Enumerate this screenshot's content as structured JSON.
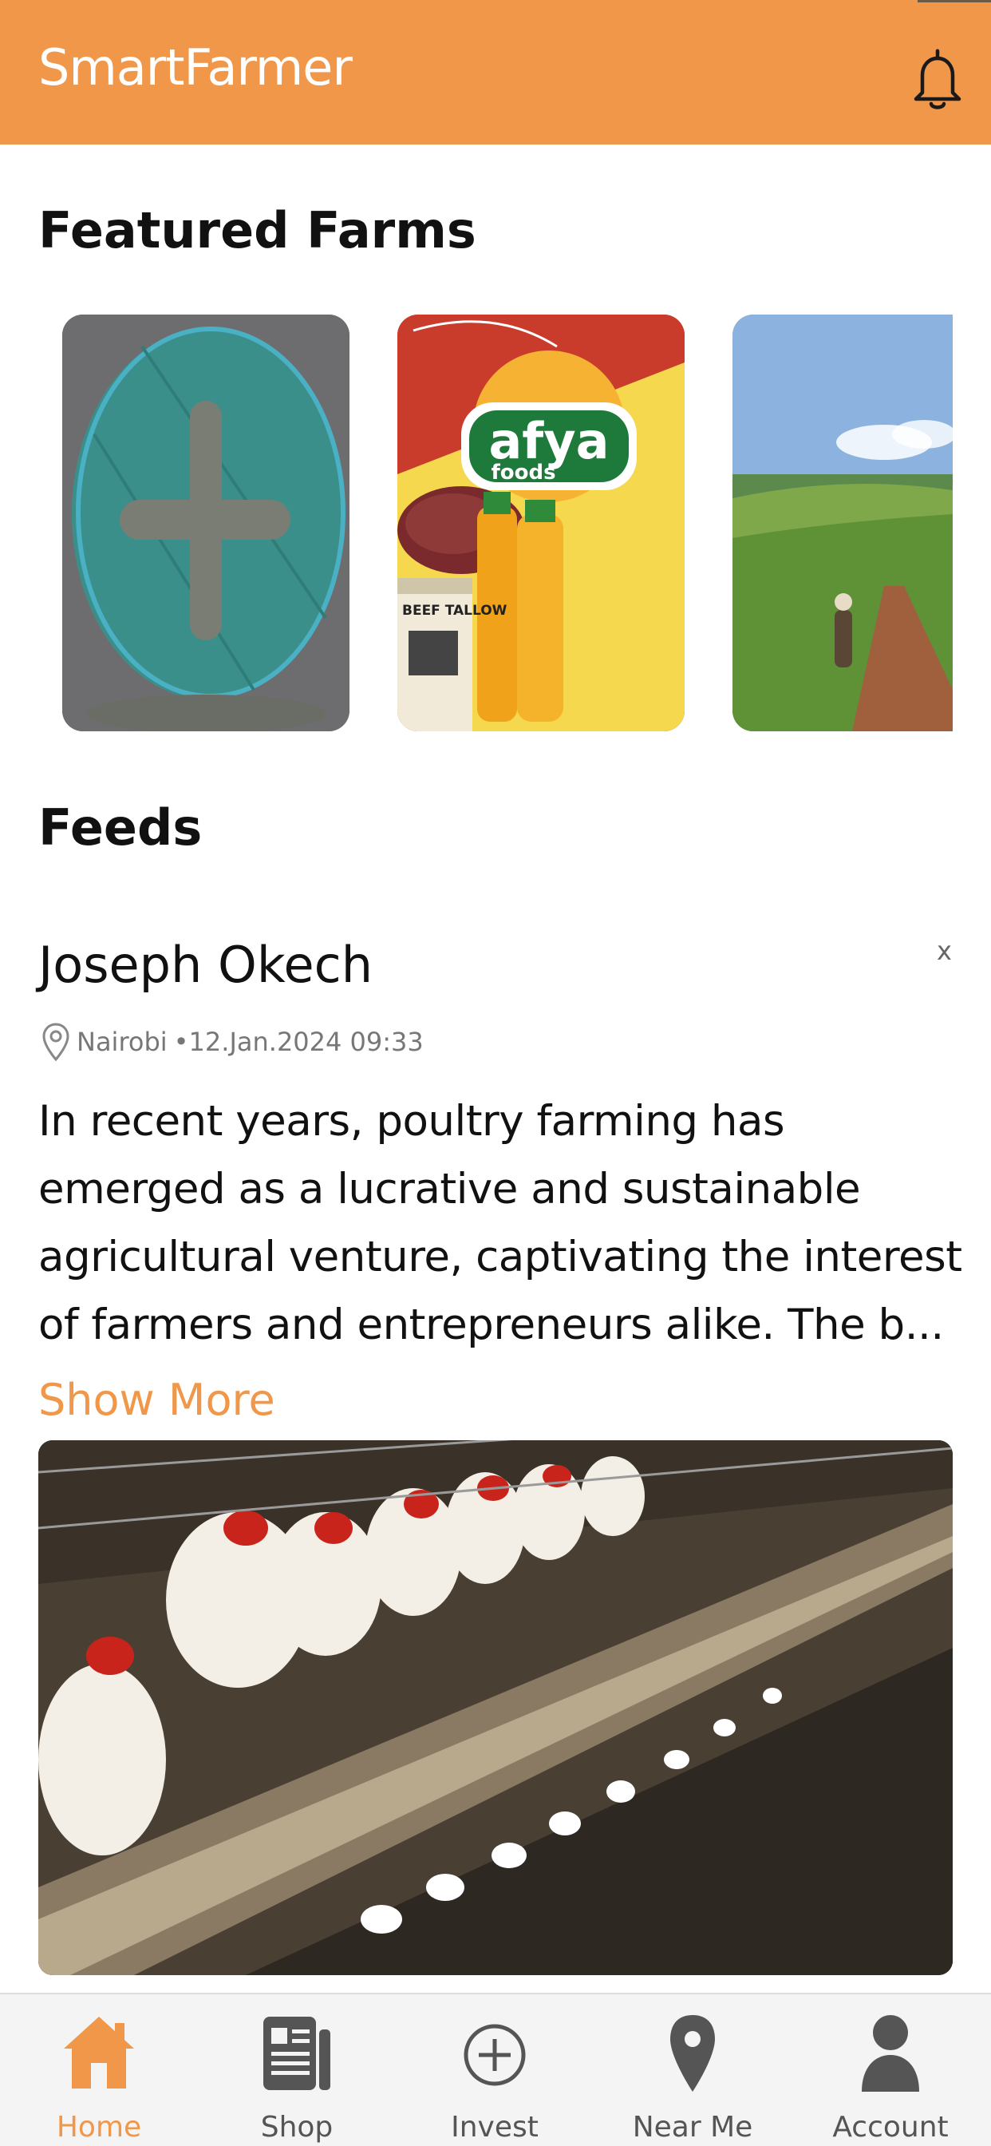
{
  "header": {
    "title": "SmartFarmer",
    "bell_icon": "bell-icon",
    "background_color": "#F0974A"
  },
  "featured": {
    "title": "Featured Farms",
    "cards": [
      {
        "name": "add-farm",
        "icon": "plus-circle-icon"
      },
      {
        "name": "afya-foods",
        "logo_text": "afya",
        "logo_subtext": "foods",
        "jar_label": "BEEF TALLOW"
      },
      {
        "name": "tea-farm"
      }
    ]
  },
  "feeds": {
    "title": "Feeds",
    "post": {
      "author": "Joseph Okech",
      "close_label": "x",
      "location": "Nairobi",
      "timestamp": "•12.Jan.2024 09:33",
      "body": "In recent years, poultry farming has emerged as a lucrative and sustainable agricultural venture, captivating the interest of farmers and entrepreneurs alike. The b...",
      "show_more_label": "Show More"
    }
  },
  "tabs": [
    {
      "label": "Home",
      "icon": "home-icon",
      "active": true
    },
    {
      "label": "Shop",
      "icon": "shop-icon",
      "active": false
    },
    {
      "label": "Invest",
      "icon": "invest-icon",
      "active": false
    },
    {
      "label": "Near Me",
      "icon": "location-pin-icon",
      "active": false
    },
    {
      "label": "Account",
      "icon": "account-icon",
      "active": false
    }
  ],
  "colors": {
    "accent": "#F0974A",
    "tab_inactive": "#555555"
  }
}
